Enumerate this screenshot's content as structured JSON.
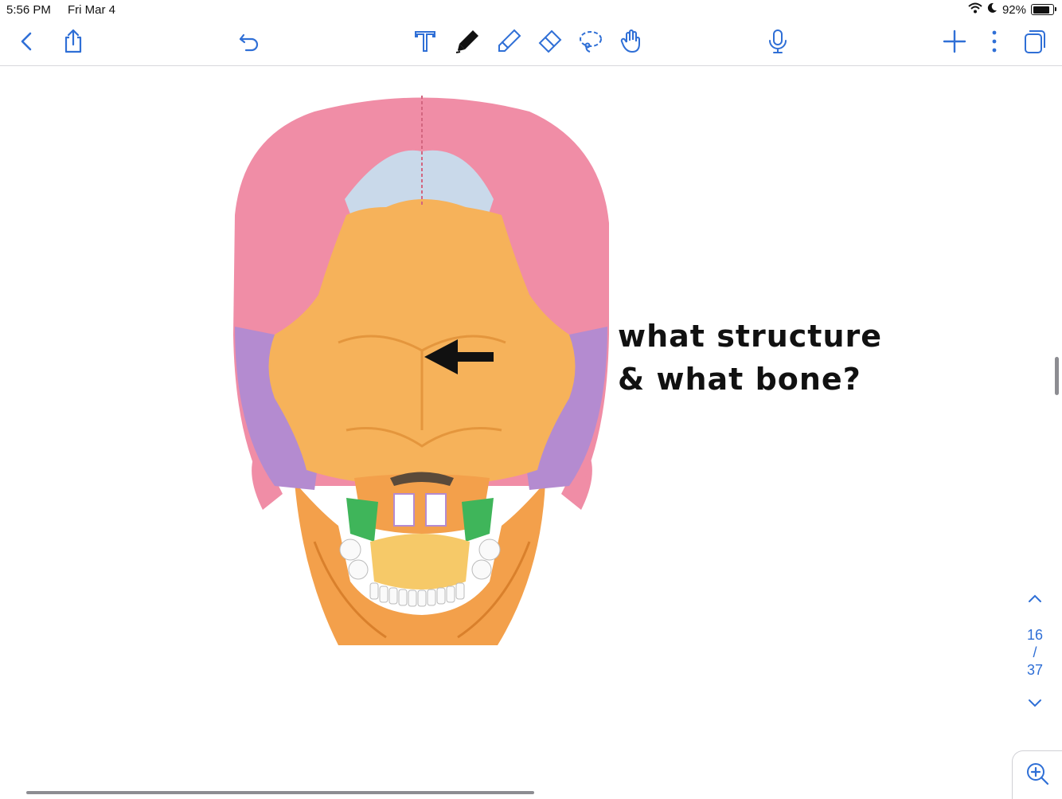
{
  "status_bar": {
    "time": "5:56 PM",
    "date": "Fri Mar 4",
    "battery": "92%",
    "battery_level": 0.92
  },
  "toolbar": {
    "left": [
      {
        "name": "back-chevron-icon"
      },
      {
        "name": "share-icon"
      },
      {
        "name": "undo-icon"
      }
    ],
    "tools": [
      {
        "name": "text-tool-icon"
      },
      {
        "name": "pen-tool-icon"
      },
      {
        "name": "highlighter-tool-icon"
      },
      {
        "name": "eraser-tool-icon"
      },
      {
        "name": "lasso-tool-icon"
      },
      {
        "name": "hand-tool-icon"
      }
    ],
    "right": [
      {
        "name": "microphone-icon"
      },
      {
        "name": "add-icon"
      },
      {
        "name": "more-icon"
      },
      {
        "name": "pages-icon"
      }
    ]
  },
  "note": {
    "handwriting_line1": "what structure",
    "handwriting_line2": "& what bone?"
  },
  "page_nav": {
    "current": "16",
    "separator": "/",
    "total": "37"
  },
  "colors": {
    "accent": "#2f6fd6",
    "parietal": "#f08da6",
    "occipital": "#f6b25a",
    "temporal": "#b48bd0",
    "sphenoid": "#c9d9ea",
    "palatine": "#3fb55a"
  }
}
